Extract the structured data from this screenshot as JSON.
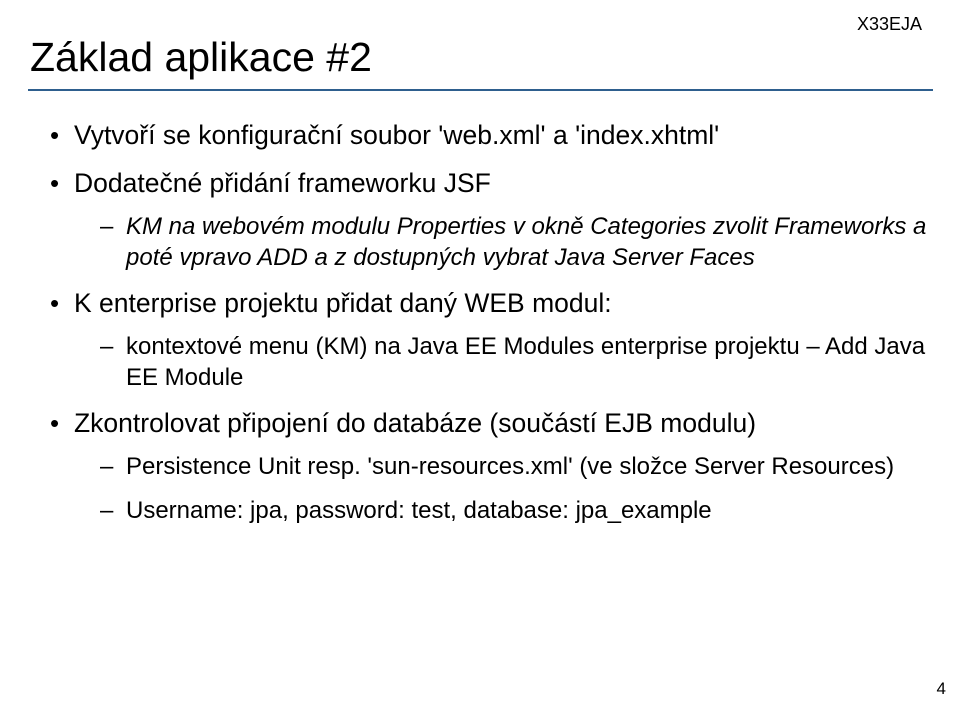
{
  "header": {
    "code": "X33EJA"
  },
  "title": "Základ aplikace #2",
  "bullets": [
    {
      "text": "Vytvoří se konfigurační soubor 'web.xml' a 'index.xhtml'"
    },
    {
      "text": "Dodatečné přidání frameworku JSF",
      "children": [
        {
          "text": "KM na webovém modulu Properties v okně Categories zvolit Frameworks a poté vpravo ADD a z dostupných vybrat Java Server Faces",
          "italic": true
        }
      ]
    },
    {
      "text": "K enterprise projektu přidat daný WEB modul:",
      "children": [
        {
          "text": "kontextové menu (KM) na Java EE Modules enterprise projektu – Add Java EE Module"
        }
      ]
    },
    {
      "text": "Zkontrolovat připojení do databáze (součástí EJB modulu)",
      "children": [
        {
          "text": "Persistence Unit resp. 'sun-resources.xml' (ve složce Server Resources)"
        },
        {
          "text": "Username: jpa, password: test, database: jpa_example"
        }
      ]
    }
  ],
  "pageNumber": "4"
}
